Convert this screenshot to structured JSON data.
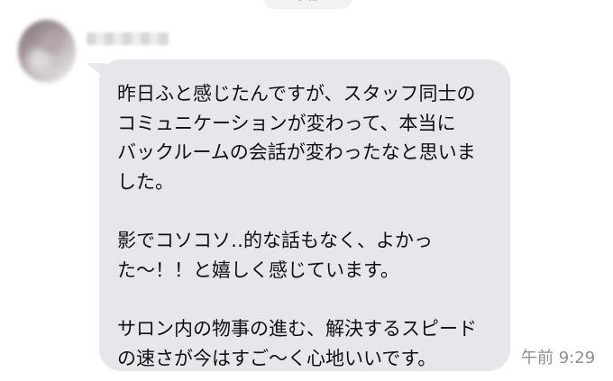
{
  "chat": {
    "date_label": "ブロ",
    "message": {
      "paragraph_1": [
        "昨日ふと感じたんですが、スタッフ同士の",
        "コミュニケーションが変わって、本当に",
        "バックルームの会話が変わったなと思いま",
        "した。"
      ],
      "paragraph_2": [
        "影でコソコソ‥的な話もなく、よかっ",
        "た〜！！と嬉しく感じています。"
      ],
      "paragraph_3": [
        "サロン内の物事の進む、解決するスピード",
        "の速さが今はすご〜く心地いいです。"
      ]
    },
    "timestamp": "午前 9:29"
  }
}
